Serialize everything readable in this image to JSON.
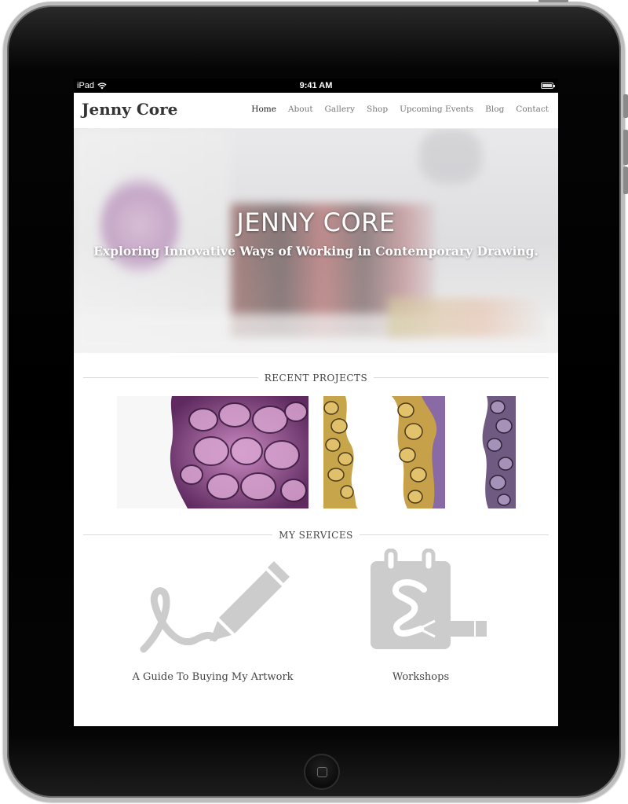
{
  "status_bar": {
    "carrier": "iPad",
    "time": "9:41 AM"
  },
  "site": {
    "title": "Jenny Core"
  },
  "nav": {
    "items": [
      "Home",
      "About",
      "Gallery",
      "Shop",
      "Upcoming Events",
      "Blog",
      "Contact"
    ],
    "active": "Home"
  },
  "hero": {
    "title": "JENNY CORE",
    "subtitle": "Exploring Innovative Ways of Working in Contemporary Drawing."
  },
  "recent_projects": {
    "heading": "RECENT PROJECTS"
  },
  "services": {
    "heading": "MY SERVICES",
    "items": [
      {
        "label": "A Guide To Buying My Artwork",
        "icon": "pen-signature-icon"
      },
      {
        "label": "Workshops",
        "icon": "notepad-pencil-icon"
      }
    ]
  },
  "colors": {
    "icon_gray": "#cccccc",
    "text": "#333333",
    "nav_text": "#777777",
    "frame": "#000000"
  }
}
